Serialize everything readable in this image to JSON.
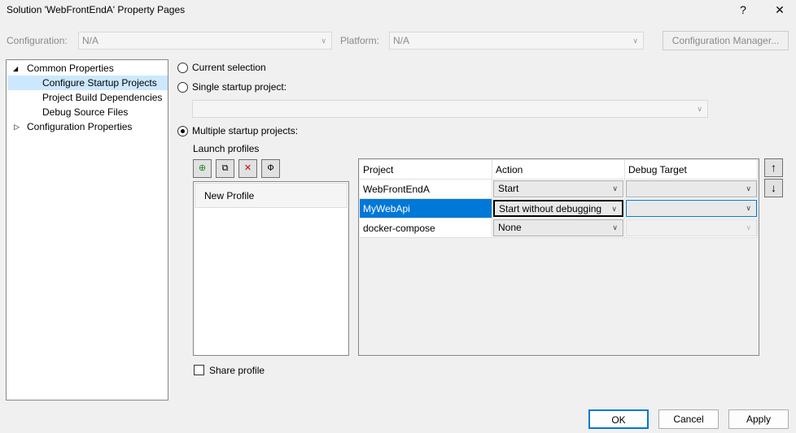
{
  "window": {
    "title": "Solution 'WebFrontEndA' Property Pages",
    "help": "?",
    "close": "✕"
  },
  "top": {
    "configuration_label": "Configuration:",
    "configuration_value": "N/A",
    "platform_label": "Platform:",
    "platform_value": "N/A",
    "config_manager": "Configuration Manager..."
  },
  "tree": {
    "items": [
      {
        "label": "Common Properties",
        "expander": "◢"
      },
      {
        "label": "Configure Startup Projects"
      },
      {
        "label": "Project Build Dependencies"
      },
      {
        "label": "Debug Source Files"
      },
      {
        "label": "Configuration Properties",
        "expander": "▷"
      }
    ]
  },
  "startup": {
    "current_selection": "Current selection",
    "single": "Single startup project:",
    "single_value": "",
    "multiple": "Multiple startup projects:",
    "launch_profiles": "Launch profiles",
    "profiles": [
      "New Profile"
    ],
    "share_profile": "Share profile"
  },
  "grid": {
    "headers": [
      "Project",
      "Action",
      "Debug Target"
    ],
    "rows": [
      {
        "project": "WebFrontEndA",
        "action": "Start",
        "target": ""
      },
      {
        "project": "MyWebApi",
        "action": "Start without debugging",
        "target": ""
      },
      {
        "project": "docker-compose",
        "action": "None",
        "target": ""
      }
    ]
  },
  "buttons": {
    "ok": "OK",
    "cancel": "Cancel",
    "apply": "Apply",
    "up": "↑",
    "down": "↓"
  },
  "colors": {
    "selection": "#0078d7",
    "tree_selected": "#cce8ff"
  }
}
